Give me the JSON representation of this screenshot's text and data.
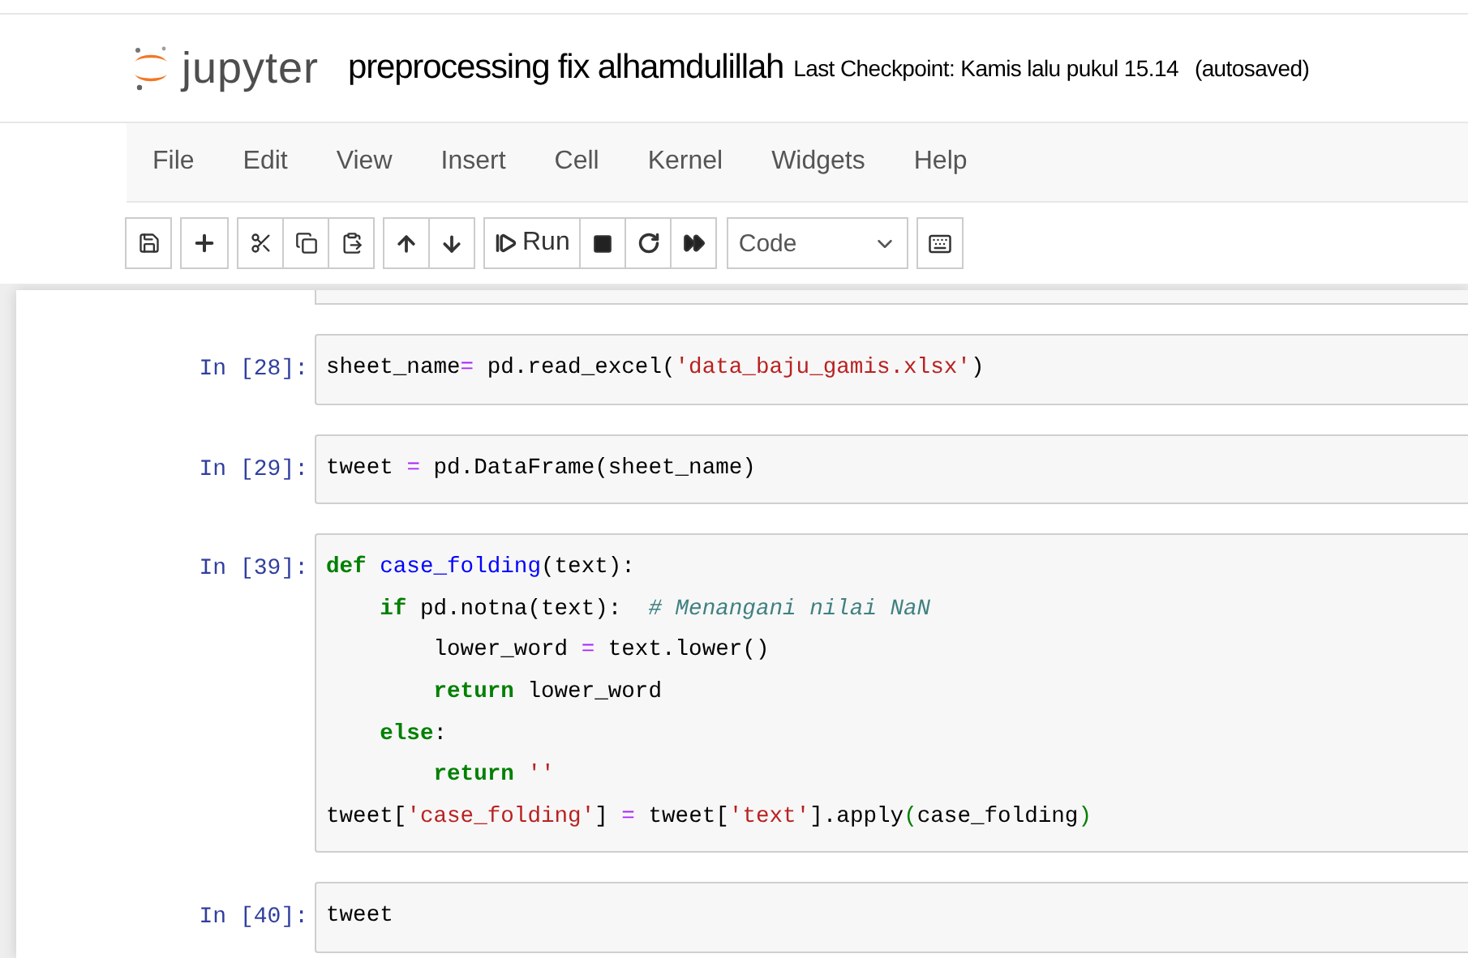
{
  "header": {
    "logo_text": "jupyter",
    "notebook_name": "preprocessing fix alhamdulillah",
    "checkpoint": "Last Checkpoint: Kamis lalu pukul 15.14",
    "autosave": "(autosaved)"
  },
  "menu": [
    "File",
    "Edit",
    "View",
    "Insert",
    "Cell",
    "Kernel",
    "Widgets",
    "Help"
  ],
  "toolbar": {
    "run_label": "Run",
    "cell_type": "Code"
  },
  "cells": [
    {
      "prompt": "In [28]:",
      "lines": [
        [
          {
            "kind": "plain",
            "text": "sheet_name"
          },
          {
            "kind": "op",
            "text": "="
          },
          {
            "kind": "plain",
            "text": " pd.read_excel("
          },
          {
            "kind": "str",
            "text": "'data_baju_gamis.xlsx'"
          },
          {
            "kind": "plain",
            "text": ")"
          }
        ]
      ]
    },
    {
      "prompt": "In [29]:",
      "lines": [
        [
          {
            "kind": "plain",
            "text": "tweet "
          },
          {
            "kind": "op",
            "text": "="
          },
          {
            "kind": "plain",
            "text": " pd.DataFrame(sheet_name)"
          }
        ]
      ]
    },
    {
      "prompt": "In [39]:",
      "lines": [
        [
          {
            "kind": "kw",
            "text": "def "
          },
          {
            "kind": "def",
            "text": "case_folding"
          },
          {
            "kind": "plain",
            "text": "(text):"
          }
        ],
        [
          {
            "kind": "kw",
            "text": "    if"
          },
          {
            "kind": "plain",
            "text": " pd.notna(text):  "
          },
          {
            "kind": "cm",
            "text": "# Menangani nilai NaN"
          }
        ],
        [
          {
            "kind": "plain",
            "text": "        lower_word "
          },
          {
            "kind": "op",
            "text": "="
          },
          {
            "kind": "plain",
            "text": " text.lower()"
          }
        ],
        [
          {
            "kind": "kw",
            "text": "        return"
          },
          {
            "kind": "plain",
            "text": " lower_word"
          }
        ],
        [
          {
            "kind": "kw",
            "text": "    else"
          },
          {
            "kind": "plain",
            "text": ":"
          }
        ],
        [
          {
            "kind": "kw",
            "text": "        return "
          },
          {
            "kind": "str",
            "text": "''"
          }
        ],
        [
          {
            "kind": "plain",
            "text": "tweet["
          },
          {
            "kind": "str",
            "text": "'case_folding'"
          },
          {
            "kind": "plain",
            "text": "] "
          },
          {
            "kind": "op",
            "text": "="
          },
          {
            "kind": "plain",
            "text": " tweet["
          },
          {
            "kind": "str",
            "text": "'text'"
          },
          {
            "kind": "plain",
            "text": "].apply"
          },
          {
            "kind": "paren",
            "text": "("
          },
          {
            "kind": "plain",
            "text": "case_folding"
          },
          {
            "kind": "paren",
            "text": ")"
          }
        ]
      ]
    },
    {
      "prompt": "In [40]:",
      "lines": [
        [
          {
            "kind": "plain",
            "text": "tweet"
          }
        ]
      ]
    }
  ]
}
